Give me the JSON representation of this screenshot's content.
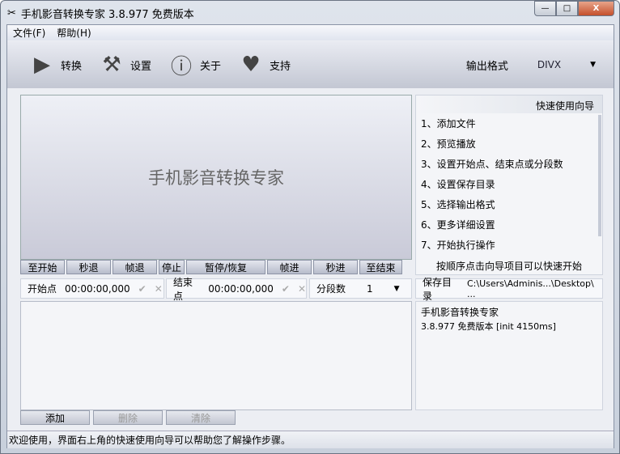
{
  "window": {
    "title": "手机影音转换专家 3.8.977 免费版本",
    "minimize": "—",
    "maximize": "□",
    "close": "X"
  },
  "menu": [
    "文件(F)",
    "帮助(H)"
  ],
  "toolbar": [
    {
      "label": "转换",
      "icon": "play-icon",
      "glyph": "▶"
    },
    {
      "label": "设置",
      "icon": "tools-icon",
      "glyph": "⚒"
    },
    {
      "label": "关于",
      "icon": "info-icon",
      "glyph": "ⓘ"
    },
    {
      "label": "支持",
      "icon": "heart-icon",
      "glyph": "♥"
    }
  ],
  "output": {
    "label": "输出格式",
    "value": "DIVX",
    "arrow": "▼"
  },
  "video": {
    "placeholder": "手机影音转换专家"
  },
  "controls": [
    "至开始",
    "秒退",
    "帧退",
    "停止",
    "暂停/恢复",
    "帧进",
    "秒进",
    "至结束"
  ],
  "start": {
    "label": "开始点",
    "value": "00:00:00,000"
  },
  "end": {
    "label": "结束点",
    "value": "00:00:00,000"
  },
  "segments": {
    "label": "分段数",
    "value": "1"
  },
  "check": "✔",
  "clear": "✕",
  "save": {
    "label": "保存目录",
    "value": "C:\\Users\\Adminis...\\Desktop\\ ..."
  },
  "guide": {
    "title": "快速使用向导",
    "items": [
      "1、添加文件",
      "2、预览播放",
      "3、设置开始点、结束点或分段数",
      "4、设置保存目录",
      "5、选择输出格式",
      "6、更多详细设置",
      "7、开始执行操作"
    ],
    "footer": "按顺序点击向导项目可以快速开始"
  },
  "info": {
    "line1": "手机影音转换专家",
    "line2": "3.8.977 免费版本 [init 4150ms]"
  },
  "buttons": {
    "add": "添加",
    "delete": "删除",
    "clear": "清除"
  },
  "status": "欢迎使用，界面右上角的快速使用向导可以帮助您了解操作步骤。"
}
